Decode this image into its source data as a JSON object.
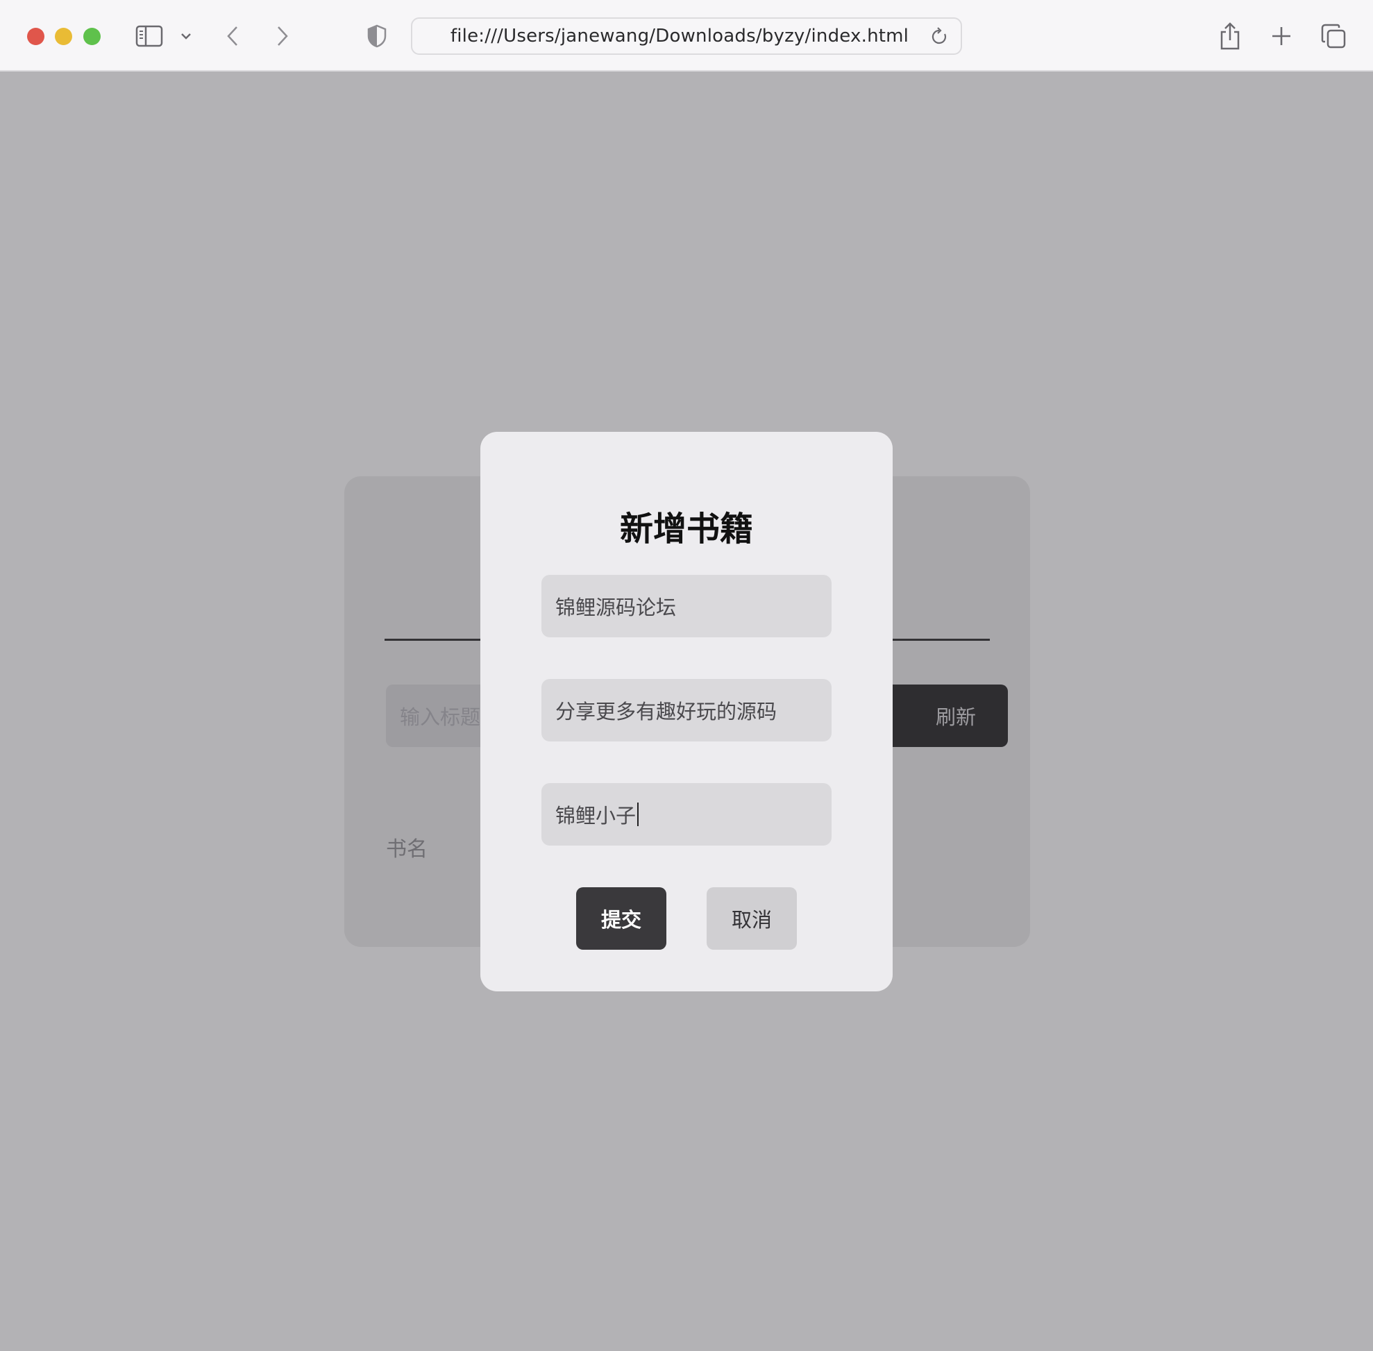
{
  "browser": {
    "url": "file:///Users/janewang/Downloads/byzy/index.html"
  },
  "background_page": {
    "search_placeholder": "输入标题",
    "refresh_label": "刷新",
    "column_label": "书名"
  },
  "modal": {
    "title": "新增书籍",
    "fields": [
      {
        "value": "锦鲤源码论坛"
      },
      {
        "value": "分享更多有趣好玩的源码"
      },
      {
        "value": "锦鲤小子"
      }
    ],
    "submit_label": "提交",
    "cancel_label": "取消"
  }
}
